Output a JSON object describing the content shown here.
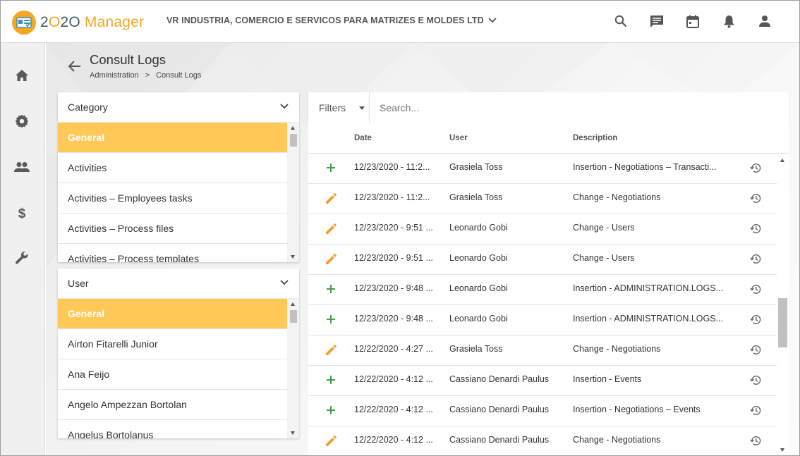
{
  "app": {
    "name_prefix": "2",
    "name_mid": "O",
    "name_suffix": "2O",
    "name_word": "Manager",
    "company": "VR INDUSTRIA, COMERCIO E SERVICOS PARA MATRIZES E MOLDES LTD"
  },
  "colors": {
    "accent": "#ffc857",
    "brand": "#f5a623",
    "insert": "#43a047",
    "edit": "#f0a030"
  },
  "topbar": {
    "icons": [
      "search-icon",
      "chat-icon",
      "calendar-icon",
      "bell-icon",
      "person-icon"
    ]
  },
  "sidebar": {
    "icons": [
      "home-icon",
      "gear-icon",
      "people-icon",
      "dollar-icon",
      "wrench-icon"
    ]
  },
  "page": {
    "title": "Consult Logs",
    "breadcrumb": [
      "Administration",
      "Consult Logs"
    ],
    "breadcrumb_sep": ">"
  },
  "category_panel": {
    "title": "Category",
    "items": [
      "General",
      "Activities",
      "Activities – Employees tasks",
      "Activities – Process files",
      "Activities – Process templates"
    ]
  },
  "user_panel": {
    "title": "User",
    "items": [
      "General",
      "Airton Fitarelli Junior",
      "Ana Feijo",
      "Angelo Ampezzan Bortolan",
      "Angelus Bortolanus"
    ]
  },
  "filters": {
    "label": "Filters",
    "search_placeholder": "Search..."
  },
  "table": {
    "columns": [
      "Date",
      "User",
      "Description"
    ],
    "rows": [
      {
        "type": "insert",
        "date": "12/23/2020 - 11:2...",
        "user": "Grasiela Toss",
        "description": "Insertion - Negotiations – Transacti..."
      },
      {
        "type": "edit",
        "date": "12/23/2020 - 11:2...",
        "user": "Grasiela Toss",
        "description": "Change - Negotiations"
      },
      {
        "type": "edit",
        "date": "12/23/2020 - 9:51 ...",
        "user": "Leonardo Gobi",
        "description": "Change - Users"
      },
      {
        "type": "edit",
        "date": "12/23/2020 - 9:51 ...",
        "user": "Leonardo Gobi",
        "description": "Change - Users"
      },
      {
        "type": "insert",
        "date": "12/23/2020 - 9:48 ...",
        "user": "Leonardo Gobi",
        "description": "Insertion - ADMINISTRATION.LOGS...."
      },
      {
        "type": "insert",
        "date": "12/23/2020 - 9:48 ...",
        "user": "Leonardo Gobi",
        "description": "Insertion - ADMINISTRATION.LOGS...."
      },
      {
        "type": "edit",
        "date": "12/22/2020 - 4:27 ...",
        "user": "Grasiela Toss",
        "description": "Change - Negotiations"
      },
      {
        "type": "insert",
        "date": "12/22/2020 - 4:12 ...",
        "user": "Cassiano Denardi Paulus",
        "description": "Insertion - Events"
      },
      {
        "type": "insert",
        "date": "12/22/2020 - 4:12 ...",
        "user": "Cassiano Denardi Paulus",
        "description": "Insertion - Negotiations – Events"
      },
      {
        "type": "edit",
        "date": "12/22/2020 - 4:12 ...",
        "user": "Cassiano Denardi Paulus",
        "description": "Change - Negotiations"
      }
    ]
  }
}
